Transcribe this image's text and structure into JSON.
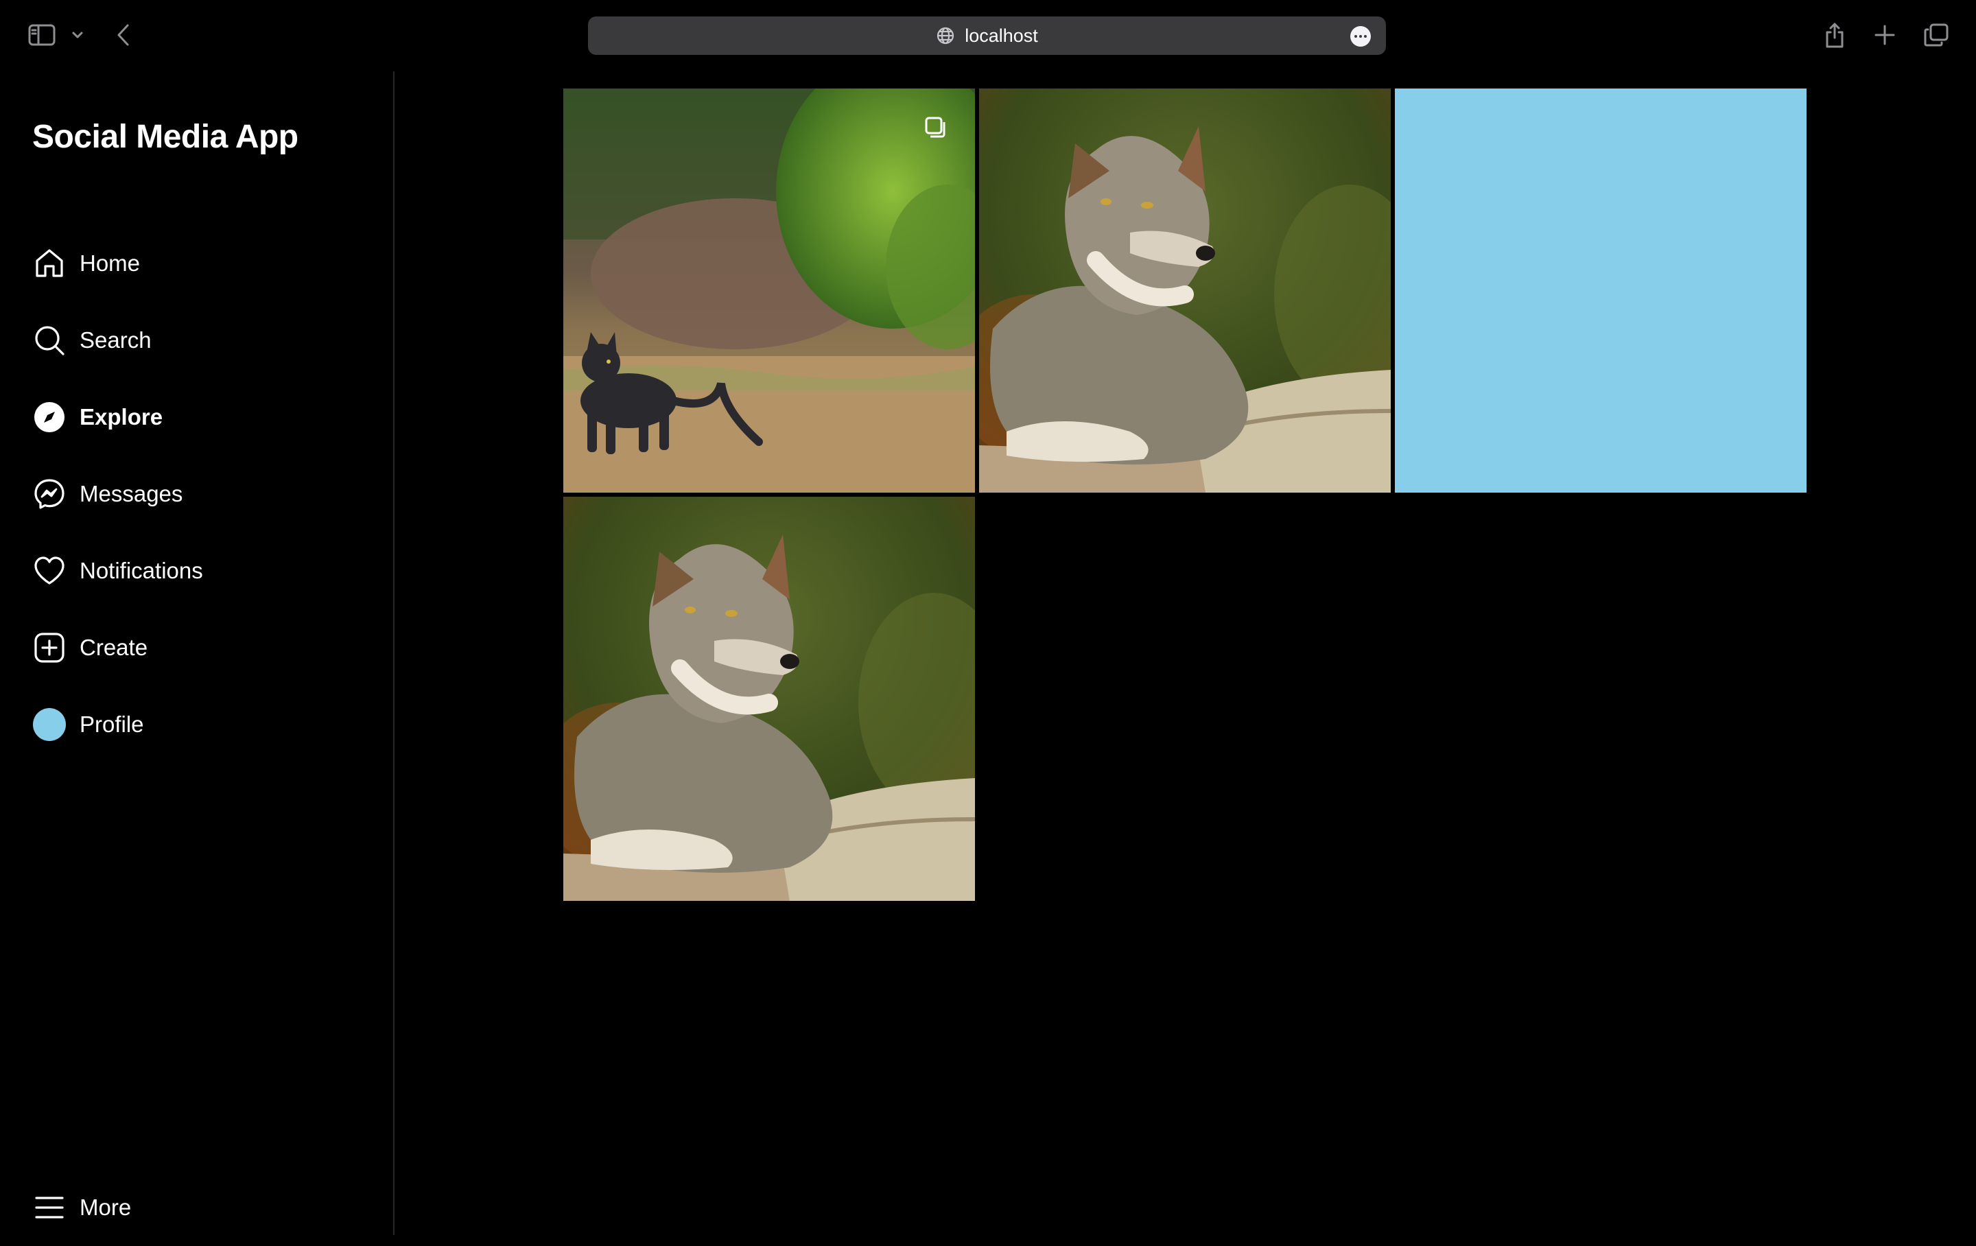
{
  "browser": {
    "url": "localhost",
    "icons": [
      "sidebar-toggle-icon",
      "chevron-down-icon",
      "back-arrow-icon",
      "globe-icon",
      "ellipsis-icon",
      "share-icon",
      "plus-icon",
      "tabs-overview-icon"
    ]
  },
  "app": {
    "title": "Social Media App"
  },
  "nav": {
    "items": [
      {
        "label": "Home",
        "icon": "home-icon"
      },
      {
        "label": "Search",
        "icon": "search-icon"
      },
      {
        "label": "Explore",
        "icon": "compass-icon",
        "active": true
      },
      {
        "label": "Messages",
        "icon": "messenger-icon"
      },
      {
        "label": "Notifications",
        "icon": "heart-icon"
      },
      {
        "label": "Create",
        "icon": "plus-square-icon"
      },
      {
        "label": "Profile",
        "icon": "avatar"
      }
    ],
    "more": {
      "label": "More",
      "icon": "hamburger-icon"
    }
  },
  "grid": {
    "tiles": [
      {
        "subject": "black cat in field",
        "multi": true
      },
      {
        "subject": "wolf on rock",
        "multi": false
      },
      {
        "subject": "blank",
        "color": "#87CEEB",
        "multi": false
      },
      {
        "subject": "wolf on rock",
        "multi": false
      }
    ]
  },
  "colors": {
    "background": "#000000",
    "avatar": "#87CEEB",
    "placeholder_tile": "#87CEEB",
    "divider": "#262626"
  }
}
